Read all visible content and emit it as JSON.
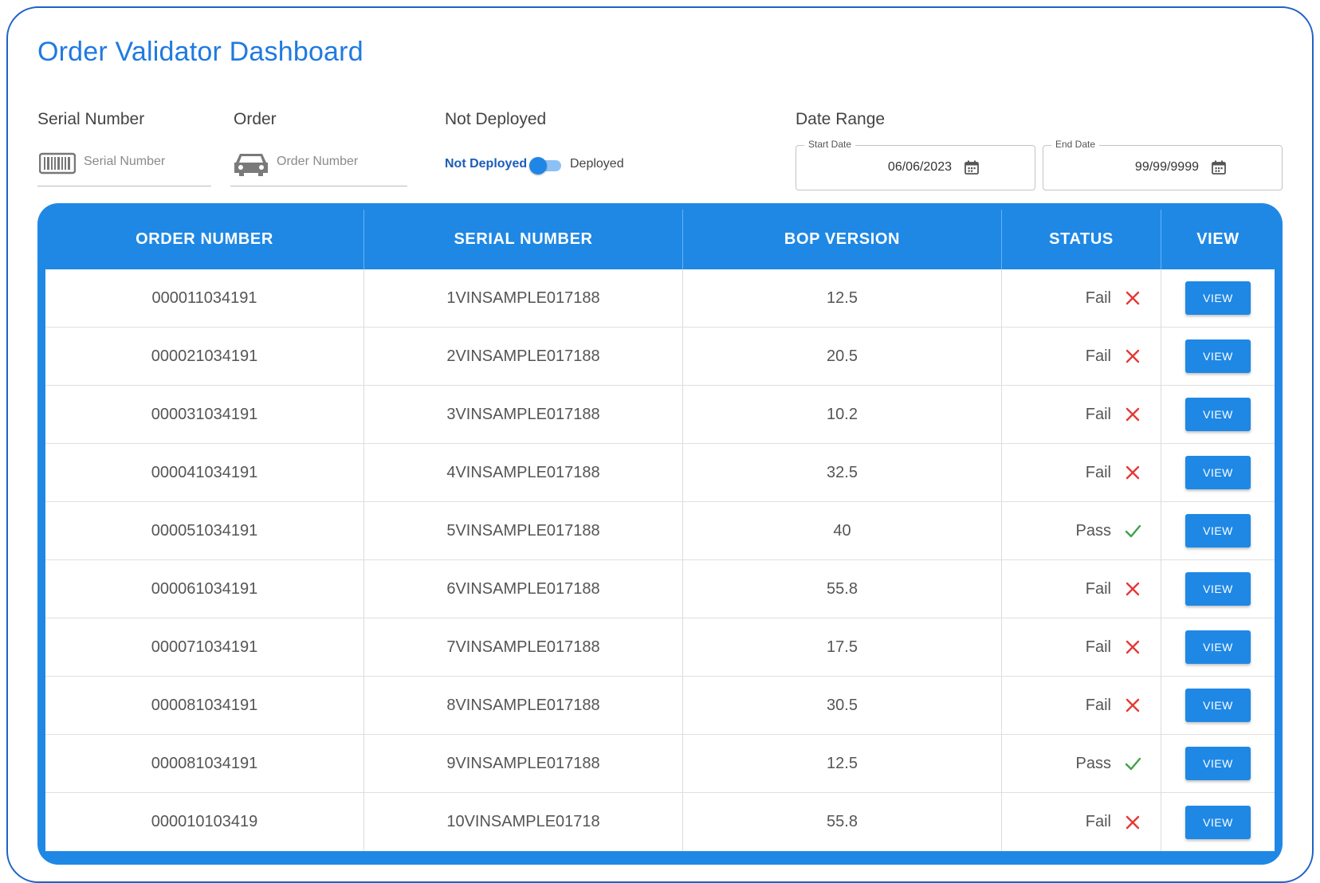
{
  "header": {
    "title": "Order Validator Dashboard"
  },
  "filters": {
    "serial": {
      "label": "Serial Number",
      "placeholder": "Serial Number",
      "value": ""
    },
    "order": {
      "label": "Order",
      "placeholder": "Order Number",
      "value": ""
    },
    "deployed": {
      "label": "Not Deployed",
      "off_label": "Not Deployed",
      "on_label": "Deployed",
      "checked": false
    },
    "date_range": {
      "label": "Date Range",
      "start": {
        "label": "Start Date",
        "value": "06/06/2023"
      },
      "end": {
        "label": "End Date",
        "value": "99/99/9999"
      }
    }
  },
  "table": {
    "columns": [
      "ORDER NUMBER",
      "SERIAL NUMBER",
      "BOP VERSION",
      "STATUS",
      "VIEW"
    ],
    "view_label": "VIEW",
    "rows": [
      {
        "order": "000011034191",
        "serial": "1VINSAMPLE017188",
        "bop": "12.5",
        "status": "Fail"
      },
      {
        "order": "000021034191",
        "serial": "2VINSAMPLE017188",
        "bop": "20.5",
        "status": "Fail"
      },
      {
        "order": "000031034191",
        "serial": "3VINSAMPLE017188",
        "bop": "10.2",
        "status": "Fail"
      },
      {
        "order": "000041034191",
        "serial": "4VINSAMPLE017188",
        "bop": "32.5",
        "status": "Fail"
      },
      {
        "order": "000051034191",
        "serial": "5VINSAMPLE017188",
        "bop": "40",
        "status": "Pass"
      },
      {
        "order": "000061034191",
        "serial": "6VINSAMPLE017188",
        "bop": "55.8",
        "status": "Fail"
      },
      {
        "order": "000071034191",
        "serial": "7VINSAMPLE017188",
        "bop": "17.5",
        "status": "Fail"
      },
      {
        "order": "000081034191",
        "serial": "8VINSAMPLE017188",
        "bop": "30.5",
        "status": "Fail"
      },
      {
        "order": "000081034191",
        "serial": "9VINSAMPLE017188",
        "bop": "12.5",
        "status": "Pass"
      },
      {
        "order": "000010103419",
        "serial": "10VINSAMPLE01718",
        "bop": "55.8",
        "status": "Fail"
      }
    ]
  },
  "icons": {
    "serial": "barcode-icon",
    "order": "car-icon",
    "calendar": "calendar-icon",
    "fail": "close-icon",
    "pass": "check-icon"
  },
  "colors": {
    "accent": "#1f88e5",
    "title": "#1f7ae0",
    "fail": "#e53935",
    "pass": "#43a047"
  }
}
